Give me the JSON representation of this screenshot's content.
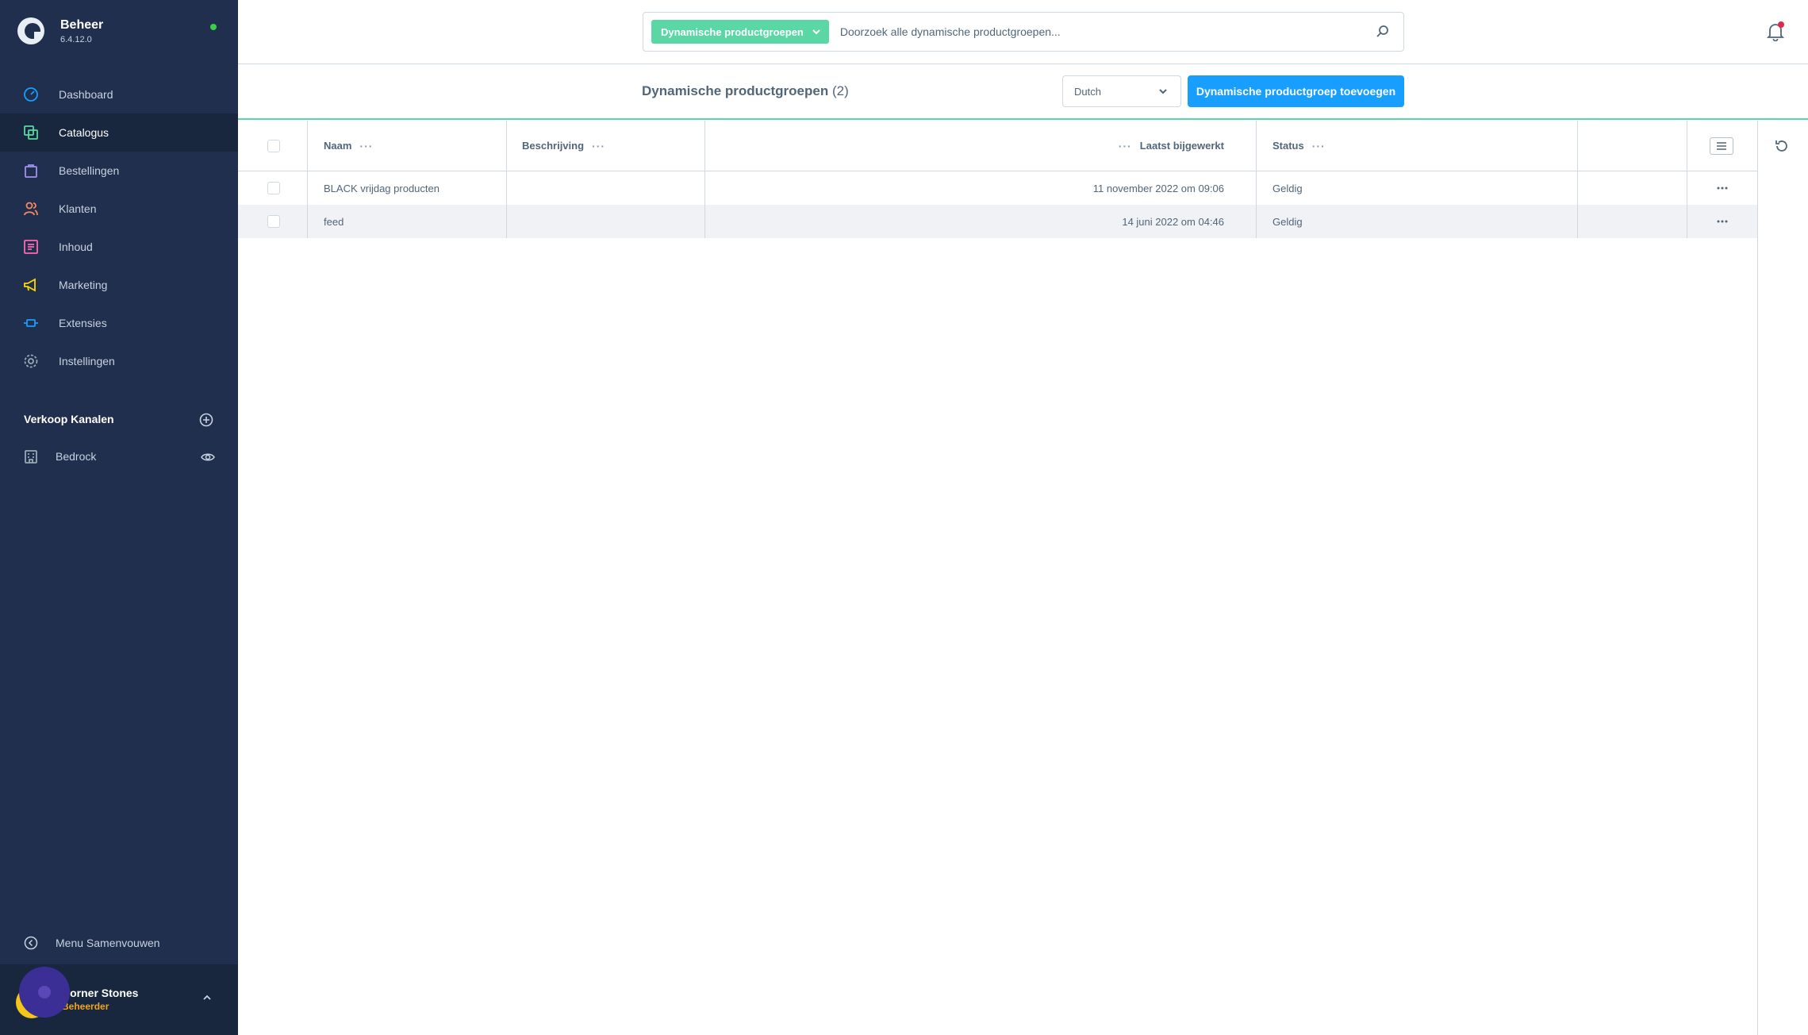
{
  "brand": {
    "title": "Beheer",
    "version": "6.4.12.0"
  },
  "nav": {
    "items": [
      {
        "label": "Dashboard",
        "icon": "dashboard-icon",
        "color": "#189eff"
      },
      {
        "label": "Catalogus",
        "icon": "catalog-icon",
        "color": "#57d9a3"
      },
      {
        "label": "Bestellingen",
        "icon": "orders-icon",
        "color": "#a092f0"
      },
      {
        "label": "Klanten",
        "icon": "customers-icon",
        "color": "#f88962"
      },
      {
        "label": "Inhoud",
        "icon": "content-icon",
        "color": "#ff68b4"
      },
      {
        "label": "Marketing",
        "icon": "marketing-icon",
        "color": "#ffd700"
      },
      {
        "label": "Extensies",
        "icon": "extensions-icon",
        "color": "#189eff"
      },
      {
        "label": "Instellingen",
        "icon": "settings-icon",
        "color": "#9aa8b5"
      }
    ],
    "active": "Catalogus"
  },
  "sales_channels": {
    "title": "Verkoop Kanalen",
    "items": [
      {
        "label": "Bedrock"
      }
    ]
  },
  "sidebar_footer": {
    "collapse_label": "Menu Samenvouwen",
    "user_name": "Corner Stones",
    "user_role": "Beheerder"
  },
  "search": {
    "type_label": "Dynamische productgroepen",
    "placeholder": "Doorzoek alle dynamische productgroepen..."
  },
  "header": {
    "title": "Dynamische productgroepen",
    "count": "(2)",
    "language": "Dutch",
    "add_button": "Dynamische productgroep toevoegen"
  },
  "table": {
    "columns": {
      "name": "Naam",
      "description": "Beschrijving",
      "updated": "Laatst bijgewerkt",
      "status": "Status"
    },
    "rows": [
      {
        "name": "BLACK vrijdag producten",
        "description": "",
        "updated": "11 november 2022 om 09:06",
        "status": "Geldig"
      },
      {
        "name": "feed",
        "description": "",
        "updated": "14 juni 2022 om 04:46",
        "status": "Geldig"
      }
    ]
  },
  "colors": {
    "sidebar": "#1f2f4d",
    "accent": "#189eff",
    "highlight": "#5bd7a6"
  }
}
